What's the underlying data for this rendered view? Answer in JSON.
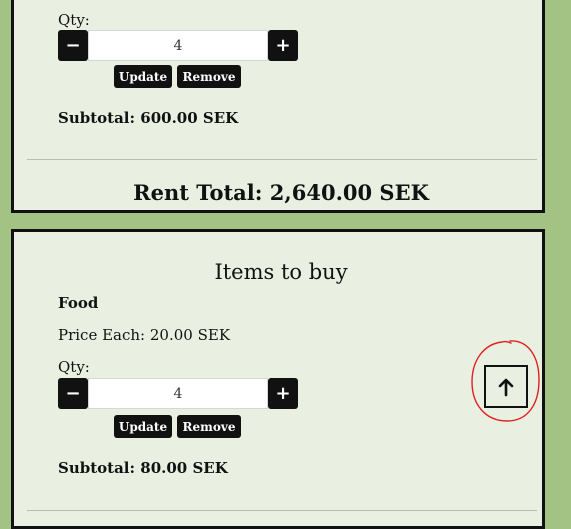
{
  "rent_section": {
    "qty_label": "Qty:",
    "qty_value": "4",
    "minus_symbol": "−",
    "plus_symbol": "+",
    "update_label": "Update",
    "remove_label": "Remove",
    "subtotal": "Subtotal: 600.00 SEK",
    "rent_total": "Rent Total: 2,640.00 SEK"
  },
  "buy_section": {
    "title": "Items to buy",
    "item": {
      "name": "Food",
      "price_each": "Price Each: 20.00 SEK",
      "qty_label": "Qty:",
      "qty_value": "4",
      "minus_symbol": "−",
      "plus_symbol": "+",
      "update_label": "Update",
      "remove_label": "Remove",
      "subtotal": "Subtotal: 80.00 SEK"
    }
  },
  "back_to_top": {
    "icon": "arrow-up-icon"
  },
  "colors": {
    "page_background": "#a3c384",
    "card_background": "#e9f0e2",
    "button_background": "#111111",
    "annotation_red": "#e02020"
  }
}
